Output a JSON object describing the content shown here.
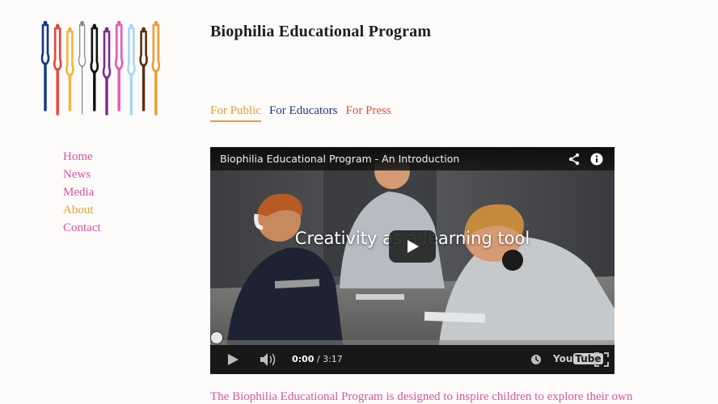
{
  "site": {
    "title": "Biophilia Educational Program"
  },
  "logo": {
    "colors": [
      "#12378b",
      "#e8433a",
      "#f2b43c",
      "#8b8b8b",
      "#111111",
      "#7b2a8c",
      "#e25ab4",
      "#a6d6f5",
      "#5a2d12",
      "#f39b2d"
    ]
  },
  "sidebar": {
    "items": [
      {
        "label": "Home",
        "color": "#d9559f"
      },
      {
        "label": "News",
        "color": "#d9559f"
      },
      {
        "label": "Media",
        "color": "#d9559f"
      },
      {
        "label": "About",
        "color": "#e89c2f"
      },
      {
        "label": "Contact",
        "color": "#d9559f"
      }
    ]
  },
  "tabs": [
    {
      "label": "For Public",
      "color": "#e89c2f",
      "active": true
    },
    {
      "label": "For Educators",
      "color": "#1f3589",
      "active": false
    },
    {
      "label": "For Press",
      "color": "#e04b3a",
      "active": false
    }
  ],
  "video": {
    "title": "Biophilia Educational Program - An Introduction",
    "overlay_text": "Creativity as a learning tool",
    "current_time": "0:00",
    "separator": "/",
    "duration": "3:17",
    "brand": {
      "you": "You",
      "tube": "Tube"
    },
    "progress": 0,
    "icons": [
      "share-icon",
      "info-icon",
      "play-icon",
      "volume-icon",
      "watch-later-icon",
      "fullscreen-icon"
    ]
  },
  "intro": {
    "text": "The Biophilia Educational Program is designed to inspire children to explore their own"
  }
}
